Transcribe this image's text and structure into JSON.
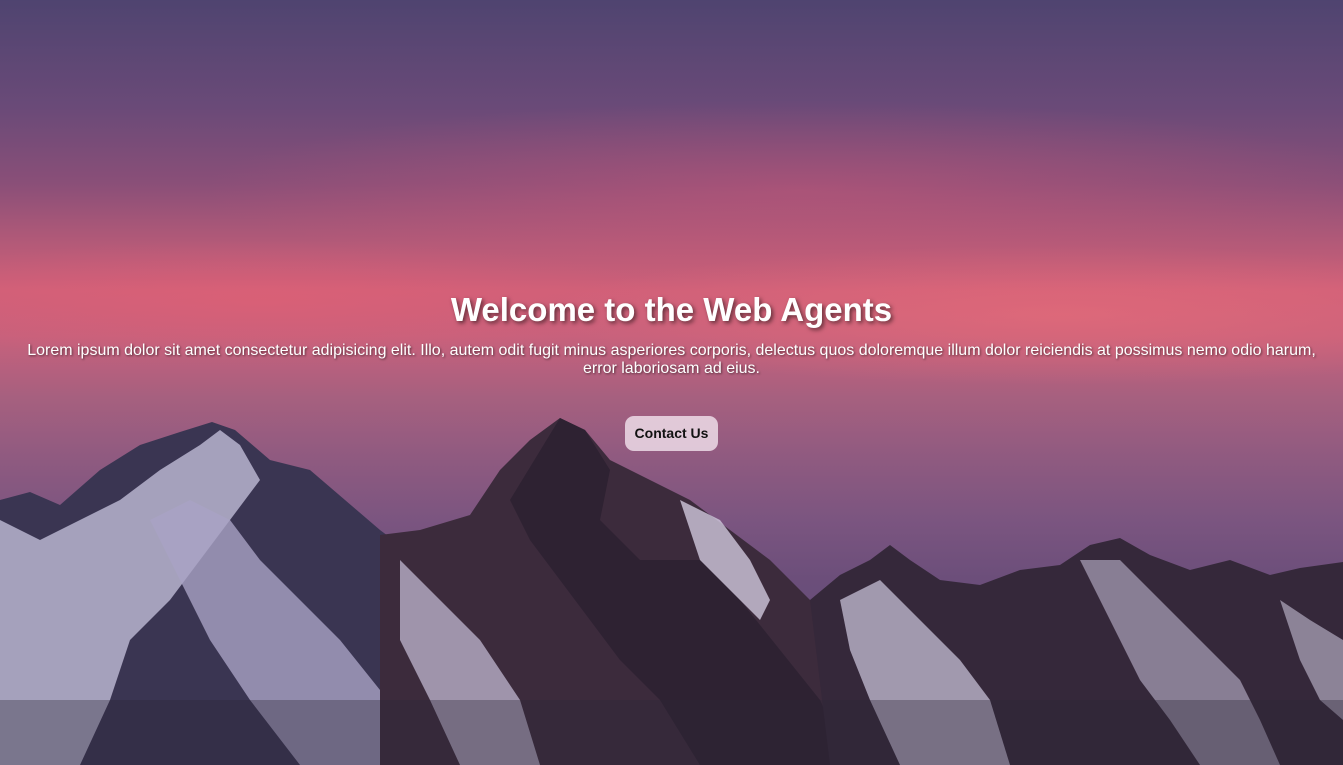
{
  "hero": {
    "title": "Welcome to the Web Agents",
    "description": "Lorem ipsum dolor sit amet consectetur adipisicing elit. Illo, autem odit fugit minus asperiores corporis, delectus quos doloremque illum dolor reiciendis at possimus nemo odio harum, error laboriosam ad eius.",
    "cta_label": "Contact Us"
  },
  "colors": {
    "text": "#ffffff",
    "button_bg": "#f0e1eb",
    "button_text": "#111111",
    "sky_top": "#4f4470",
    "sky_glow": "#cf6079"
  }
}
